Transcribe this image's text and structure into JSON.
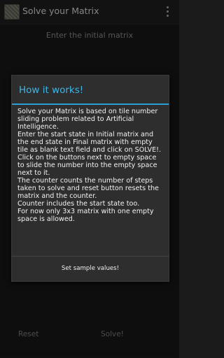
{
  "action_bar": {
    "title": "Solve your Matrix",
    "icon": "app-puzzle-icon",
    "menu_icon": "overflow-menu-icon"
  },
  "main": {
    "section_title": "Enter the initial matrix",
    "reset_label": "Reset",
    "solve_label": "Solve!"
  },
  "dialog": {
    "title": "How it works!",
    "paragraphs": [
      "Solve your Matrix is based on tile number sliding problem related to Artificial Intelligence.",
      " Enter the start state in Initial matrix and the end state in Final matrix with empty tile as blank text field and click on SOLVE!.",
      " Click on the buttons next to empty space to slide the number into the empty space next to it.",
      " The counter counts the number of steps taken to solve and reset button resets the matrix and the counter.",
      " Counter includes the start state too.",
      " For now only 3x3 matrix with one empty space is allowed."
    ],
    "button_label": "Set sample values!"
  },
  "colors": {
    "accent": "#3fb6e5",
    "divider": "#2a9fd6",
    "dialog_background": "#2e2e2e",
    "screen_background": "#1b1b1b"
  }
}
